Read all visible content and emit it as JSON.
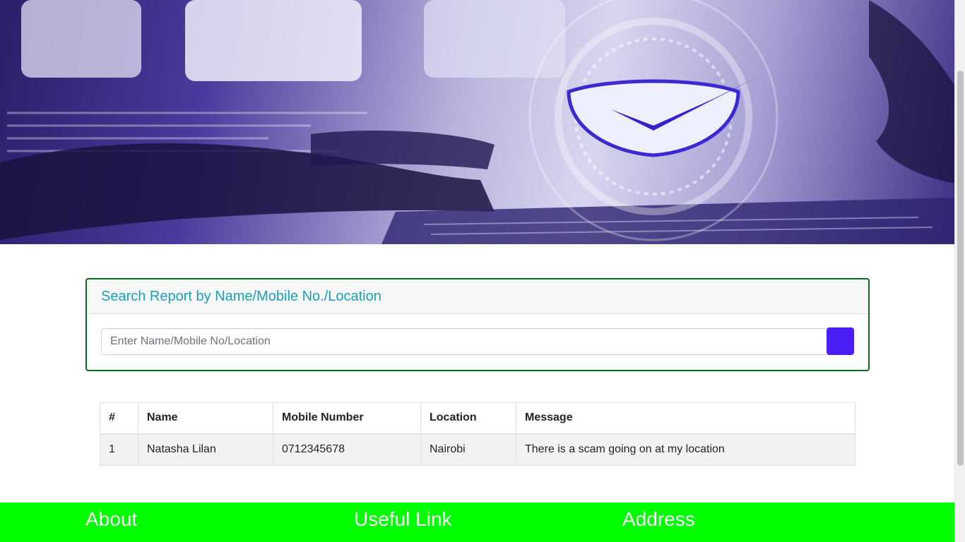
{
  "search": {
    "title": "Search Report by Name/Mobile No./Location",
    "placeholder": "Enter Name/Mobile No/Location",
    "value": ""
  },
  "table": {
    "headers": [
      "#",
      "Name",
      "Mobile Number",
      "Location",
      "Message"
    ],
    "rows": [
      [
        "1",
        "Natasha Lilan",
        "0712345678",
        "Nairobi",
        "There is a scam going on at my location"
      ]
    ]
  },
  "footer": {
    "about_heading": "About",
    "links_heading": "Useful Link",
    "address_heading": "Address"
  },
  "colors": {
    "accent_title": "#17a2b8",
    "card_border": "#0b6b1f",
    "search_button": "#4a1ff5",
    "footer_bg": "#00ff00"
  },
  "icons": {
    "hero_shield": "shield-check-icon"
  }
}
